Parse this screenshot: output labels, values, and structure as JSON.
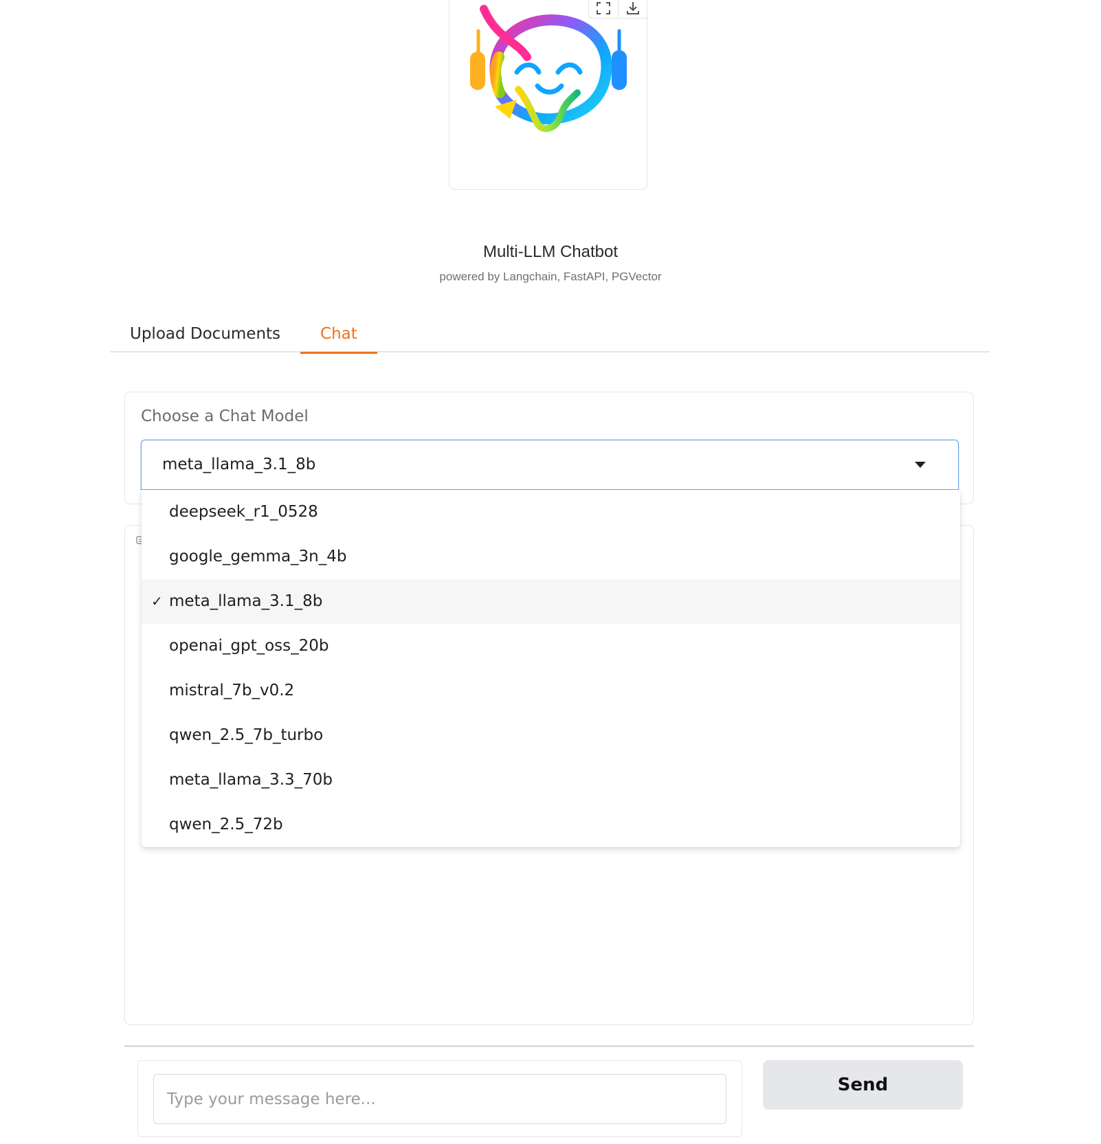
{
  "header": {
    "title": "Multi-LLM Chatbot",
    "subtitle": "powered by Langchain, FastAPI, PGVector"
  },
  "logo_toolbar": {
    "icons": [
      "fullscreen-icon",
      "download-icon"
    ]
  },
  "tabs": [
    {
      "label": "Upload Documents",
      "active": false
    },
    {
      "label": "Chat",
      "active": true
    }
  ],
  "model_selector": {
    "label": "Choose a Chat Model",
    "value": "meta_llama_3.1_8b",
    "options": [
      {
        "label": "deepseek_r1_0528",
        "selected": false
      },
      {
        "label": "google_gemma_3n_4b",
        "selected": false
      },
      {
        "label": "meta_llama_3.1_8b",
        "selected": true
      },
      {
        "label": "openai_gpt_oss_20b",
        "selected": false
      },
      {
        "label": "mistral_7b_v0.2",
        "selected": false
      },
      {
        "label": "qwen_2.5_7b_turbo",
        "selected": false
      },
      {
        "label": "meta_llama_3.3_70b",
        "selected": false
      },
      {
        "label": "qwen_2.5_72b",
        "selected": false
      }
    ],
    "check_glyph": "✓"
  },
  "message": {
    "placeholder": "Type your message here...",
    "value": ""
  },
  "send_button": {
    "label": "Send"
  },
  "colors": {
    "accent": "#f2711c",
    "focus_border": "#6fa6f2",
    "button_bg": "#e5e7ea"
  }
}
